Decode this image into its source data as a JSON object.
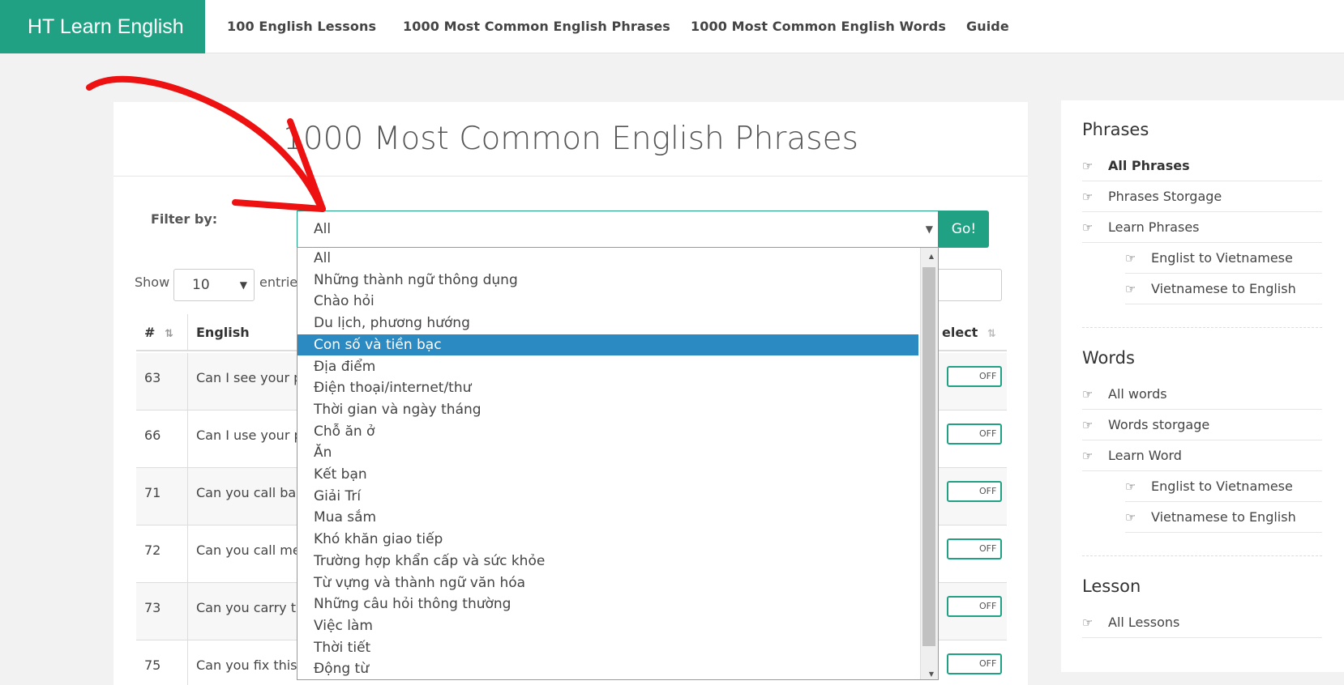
{
  "nav": {
    "brand": "HT Learn English",
    "links": [
      "100 English Lessons",
      "1000 Most Common English Phrases",
      "1000 Most Common English Words",
      "Guide"
    ]
  },
  "main": {
    "title": "1000 Most Common English Phrases",
    "filter_label": "Filter by:",
    "filter_value": "All",
    "go_label": "Go!",
    "show_label": "Show",
    "show_value": "10",
    "entries_label": "entrie",
    "table": {
      "headers": [
        "#",
        "English",
        "elect"
      ],
      "rows": [
        {
          "num": "63",
          "english": "Can I see your p",
          "toggle": "OFF"
        },
        {
          "num": "66",
          "english": "Can I use your p",
          "toggle": "OFF"
        },
        {
          "num": "71",
          "english": "Can you call ba",
          "toggle": "OFF"
        },
        {
          "num": "72",
          "english": "Can you call me",
          "toggle": "OFF"
        },
        {
          "num": "73",
          "english": "Can you carry t",
          "toggle": "OFF"
        },
        {
          "num": "75",
          "english": "Can you fix this",
          "toggle": "OFF"
        }
      ]
    }
  },
  "dropdown": {
    "options": [
      "All",
      "Những thành ngữ thông dụng",
      "Chào hỏi",
      "Du lịch, phương hướng",
      "Con số và tiền bạc",
      "Địa điểm",
      "Điện thoại/internet/thư",
      "Thời gian và ngày tháng",
      "Chỗ ăn ở",
      "Ăn",
      "Kết bạn",
      "Giải Trí",
      "Mua sắm",
      "Khó khăn giao tiếp",
      "Trường hợp khẩn cấp và sức khỏe",
      "Từ vựng và thành ngữ văn hóa",
      "Những câu hỏi thông thường",
      "Việc làm",
      "Thời tiết",
      "Động từ"
    ],
    "selected_index": 4
  },
  "sidebar": {
    "phrases_title": "Phrases",
    "phrases_items": [
      "All Phrases",
      "Phrases Storgage",
      "Learn Phrases"
    ],
    "phrases_sub": [
      "Englist to Vietnamese",
      "Vietnamese to English"
    ],
    "words_title": "Words",
    "words_items": [
      "All words",
      "Words storgage",
      "Learn Word"
    ],
    "words_sub": [
      "Englist to Vietnamese",
      "Vietnamese to English"
    ],
    "lesson_title": "Lesson",
    "lesson_items": [
      "All Lessons"
    ]
  },
  "colors": {
    "brand": "#21a184",
    "selected": "#2b8ac2",
    "annotation_arrow": "#ee1111"
  }
}
